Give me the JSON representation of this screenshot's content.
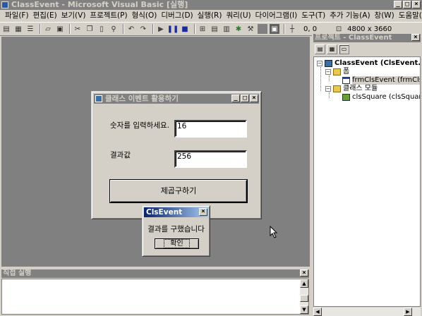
{
  "window": {
    "title": "ClassEvent - Microsoft Visual Basic [실행]",
    "buttons": [
      "_",
      "□",
      "×"
    ]
  },
  "menu": [
    "파일(F)",
    "편집(E)",
    "보기(V)",
    "프로젝트(P)",
    "형식(O)",
    "디버그(D)",
    "실행(R)",
    "쿼리(U)",
    "다이어그램(I)",
    "도구(T)",
    "추가 기능(A)",
    "창(W)",
    "도움말(H)"
  ],
  "toolbar": {
    "position": "0, 0",
    "size": "4800 x 3660"
  },
  "form": {
    "title": "클래스 이벤트 활용하기",
    "input_label": "숫자를 입력하세요.",
    "input_value": "16",
    "result_label": "결과값",
    "result_value": "256",
    "button_label": "제곱구하기"
  },
  "msgbox": {
    "title": "ClsEvent",
    "message": "결과를 구했습니다",
    "ok_label": "확인"
  },
  "immediate": {
    "title": "직접 실행"
  },
  "project": {
    "title": "프로젝트 - ClassEvent",
    "root": "ClassEvent (ClsEvent.vb",
    "forms_folder": "폼",
    "form_item": "frmClsEvent (frmClsE",
    "classes_folder": "클래스 모듈",
    "class_item": "clsSquare (clsSquare"
  },
  "colors": {
    "inactive_title": "#808080",
    "active_title": "#0a246a",
    "workspace": "#808080",
    "face": "#d4d0c8"
  }
}
